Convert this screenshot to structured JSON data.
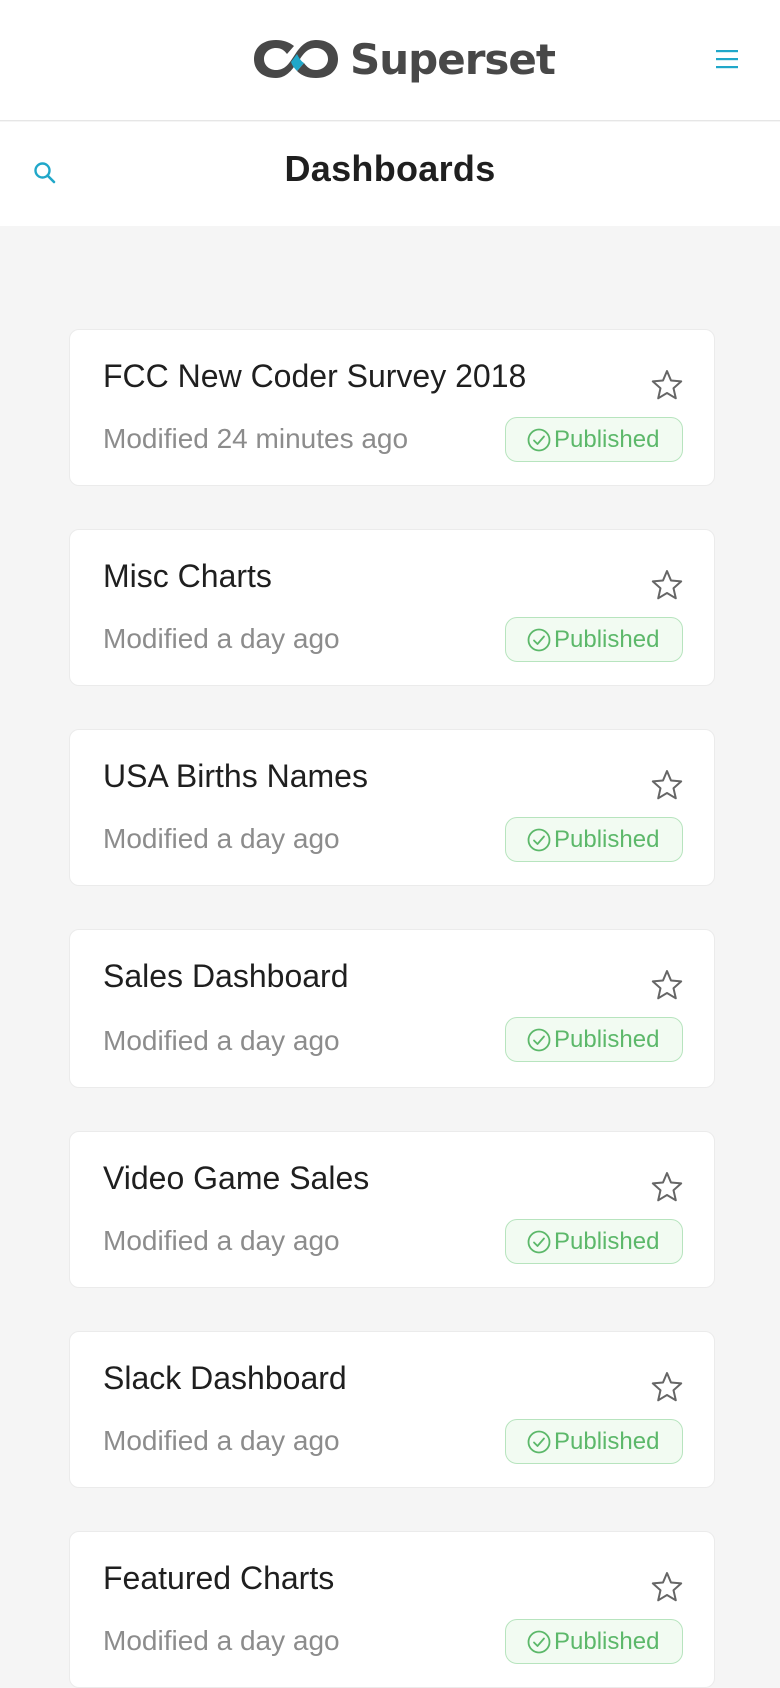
{
  "header": {
    "brand": "Superset",
    "logo_icon": "superset-infinity-logo",
    "menu_icon": "hamburger-menu-icon"
  },
  "subheader": {
    "title": "Dashboards",
    "search_icon": "search-icon"
  },
  "colors": {
    "accent": "#20a7c9",
    "logo_dark": "#484848",
    "published_text": "#5cb86a",
    "published_bg": "#f2fbf2",
    "published_border": "#b7e4be"
  },
  "dashboards": [
    {
      "title": "FCC New Coder Survey 2018",
      "modified": "Modified 24 minutes ago",
      "status": "Published",
      "favorite": false
    },
    {
      "title": "Misc Charts",
      "modified": "Modified a day ago",
      "status": "Published",
      "favorite": false
    },
    {
      "title": "USA Births Names",
      "modified": "Modified a day ago",
      "status": "Published",
      "favorite": false
    },
    {
      "title": "Sales Dashboard",
      "modified": "Modified a day ago",
      "status": "Published",
      "favorite": false
    },
    {
      "title": "Video Game Sales",
      "modified": "Modified a day ago",
      "status": "Published",
      "favorite": false
    },
    {
      "title": "Slack Dashboard",
      "modified": "Modified a day ago",
      "status": "Published",
      "favorite": false
    },
    {
      "title": "Featured Charts",
      "modified": "Modified a day ago",
      "status": "Published",
      "favorite": false
    }
  ]
}
